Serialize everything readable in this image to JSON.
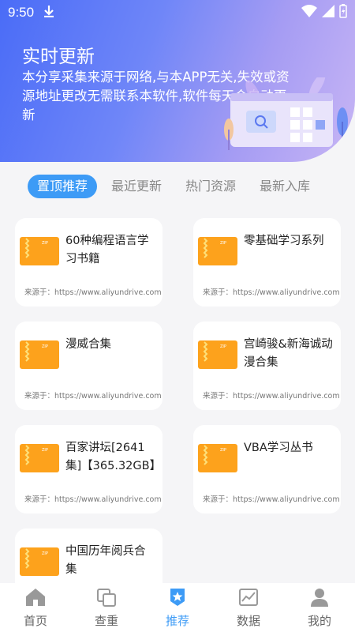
{
  "status_bar": {
    "time": "9:50"
  },
  "hero": {
    "title": "实时更新",
    "description": "本分享采集来源于网络,与本APP无关,失效或资源地址更改无需联系本软件,软件每天会自动更新"
  },
  "tabs": [
    {
      "label": "置顶推荐",
      "active": true
    },
    {
      "label": "最近更新",
      "active": false
    },
    {
      "label": "热门资源",
      "active": false
    },
    {
      "label": "最新入库",
      "active": false
    }
  ],
  "cards": [
    {
      "name": "60种编程语言学习书籍",
      "source": "来源于：https://www.aliyundrive.com"
    },
    {
      "name": "零基础学习系列",
      "source": "来源于：https://www.aliyundrive.com"
    },
    {
      "name": "漫威合集",
      "source": "来源于：https://www.aliyundrive.com"
    },
    {
      "name": "宫崎骏&新海诚动漫合集",
      "source": "来源于：https://www.aliyundrive.com"
    },
    {
      "name": "百家讲坛[2641集]【365.32GB】",
      "source": "来源于：https://www.aliyundrive.com"
    },
    {
      "name": "VBA学习丛书",
      "source": "来源于：https://www.aliyundrive.com"
    },
    {
      "name": "中国历年阅兵合集",
      "source": ""
    }
  ],
  "bottom_nav": [
    {
      "label": "首页",
      "icon": "home-icon",
      "active": false
    },
    {
      "label": "查重",
      "icon": "copy-icon",
      "active": false
    },
    {
      "label": "推荐",
      "icon": "badge-star-icon",
      "active": true
    },
    {
      "label": "数据",
      "icon": "chart-icon",
      "active": false
    },
    {
      "label": "我的",
      "icon": "user-icon",
      "active": false
    }
  ],
  "colors": {
    "accent": "#3d9bf6",
    "folder": "#fda21c",
    "hero_start": "#4a6cf7",
    "hero_end": "#c7b5f5"
  }
}
